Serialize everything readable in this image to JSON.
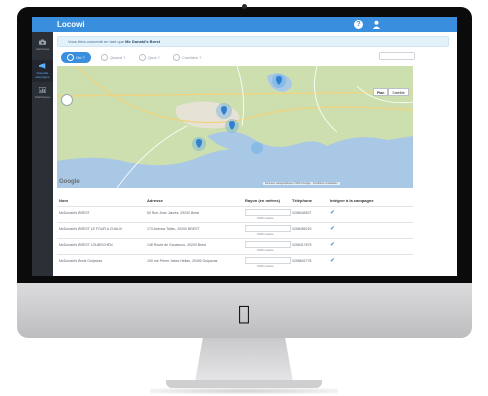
{
  "app": {
    "title": "Locowi",
    "brand_color": "#3a8ede"
  },
  "header": {
    "help_icon": "?",
    "user_icon": "user-icon"
  },
  "sidebar": {
    "items": [
      {
        "icon": "camera-icon",
        "label": "Historique",
        "active": false
      },
      {
        "icon": "megaphone-icon",
        "label": "Nouvelle campagne",
        "active": true
      },
      {
        "icon": "chart-icon",
        "label": "Statistiques",
        "active": false
      }
    ]
  },
  "info_bar": {
    "prefix": "Vous êtes connecté en tant que",
    "name": "Mc Donald's Brest"
  },
  "steps": [
    {
      "label": "Où ?",
      "active": true
    },
    {
      "label": "Quand ?",
      "active": false
    },
    {
      "label": "Quoi ?",
      "active": false
    },
    {
      "label": "Combien ?",
      "active": false
    }
  ],
  "map": {
    "toggle": [
      "Plan",
      "Satellite"
    ],
    "credit": "Données cartographiques ©2013 Google · Conditions d'utilisation",
    "provider": "Google"
  },
  "table": {
    "headers": [
      "Nom",
      "Adresse",
      "Rayon (en mètres)",
      "Téléphone",
      "Intégrer à la campagne"
    ],
    "rows": [
      {
        "name": "McDonald's BREST",
        "address": "50 Rue Jean Jaurès, 29200 Brest",
        "radius_label": "1000 mètres",
        "phone": "0298445527"
      },
      {
        "name": "McDonald's BREST LE FOUR A CHAUX",
        "address": "173 Avenue Tallec, 29200 BREST",
        "radius_label": "1000 mètres",
        "phone": "0298455215"
      },
      {
        "name": "McDonald's BREST LOUBSCHEN",
        "address": "148 Route de Gouesnou, 29200 Brest",
        "radius_label": "1000 mètres",
        "phone": "0298417879"
      },
      {
        "name": "McDonald's Brest Guipavas",
        "address": "190 rue Pierre Jakez Hélias, 29490 Guipavas",
        "radius_label": "1000 mètres",
        "phone": "0298842778"
      }
    ]
  }
}
